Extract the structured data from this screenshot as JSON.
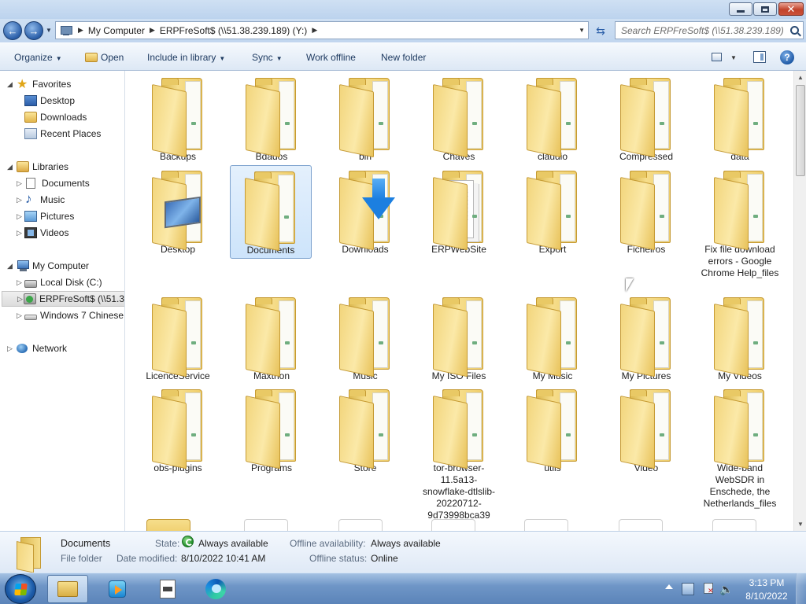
{
  "window": {
    "controls": {
      "minimize": "",
      "maximize": "",
      "close": "✕"
    }
  },
  "address": {
    "crumbs": [
      "My Computer",
      "ERPFreSoft$ (\\\\51.38.239.189) (Y:)"
    ],
    "search_placeholder": "Search ERPFreSoft$ (\\\\51.38.239.189) (..."
  },
  "toolbar": {
    "organize": "Organize",
    "open": "Open",
    "include_in_library": "Include in library",
    "sync": "Sync",
    "work_offline": "Work offline",
    "new_folder": "New folder",
    "help": "?"
  },
  "nav": {
    "favorites": {
      "label": "Favorites",
      "items": [
        "Desktop",
        "Downloads",
        "Recent Places"
      ]
    },
    "libraries": {
      "label": "Libraries",
      "items": [
        "Documents",
        "Music",
        "Pictures",
        "Videos"
      ]
    },
    "computer": {
      "label": "My Computer",
      "items": [
        "Local Disk (C:)",
        "ERPFreSoft$ (\\\\51.38.239.189) (Y:)",
        "Windows 7 Chinese"
      ]
    },
    "network": {
      "label": "Network"
    }
  },
  "folders": [
    {
      "name": "Backups",
      "overlay": "none"
    },
    {
      "name": "Bdados",
      "overlay": "none"
    },
    {
      "name": "bin",
      "overlay": "none"
    },
    {
      "name": "Chaves",
      "overlay": "none"
    },
    {
      "name": "claudio",
      "overlay": "none"
    },
    {
      "name": "Compressed",
      "overlay": "none"
    },
    {
      "name": "data",
      "overlay": "none"
    },
    {
      "name": "Desktop",
      "overlay": "desktop"
    },
    {
      "name": "Documents",
      "overlay": "none",
      "selected": true
    },
    {
      "name": "Downloads",
      "overlay": "downloads"
    },
    {
      "name": "ERPWebSite",
      "overlay": "documents"
    },
    {
      "name": "Export",
      "overlay": "none"
    },
    {
      "name": "Ficheiros",
      "overlay": "none"
    },
    {
      "name": "Fix file download errors - Google Chrome Help_files",
      "overlay": "none"
    },
    {
      "name": "LicenceService",
      "overlay": "none"
    },
    {
      "name": "Maxthon",
      "overlay": "none"
    },
    {
      "name": "Music",
      "overlay": "none"
    },
    {
      "name": "My ISO Files",
      "overlay": "none"
    },
    {
      "name": "My Music",
      "overlay": "none"
    },
    {
      "name": "My Pictures",
      "overlay": "none"
    },
    {
      "name": "My Videos",
      "overlay": "none"
    },
    {
      "name": "obs-plugins",
      "overlay": "none"
    },
    {
      "name": "Programs",
      "overlay": "none"
    },
    {
      "name": "Store",
      "overlay": "none"
    },
    {
      "name": "tor-browser-11.5a13-snowflake-dtlslib-20220712-9d73998bca39",
      "overlay": "none"
    },
    {
      "name": "utils",
      "overlay": "none"
    },
    {
      "name": "Video",
      "overlay": "none"
    },
    {
      "name": "Wide-band WebSDR in Enschede, the Netherlands_files",
      "overlay": "none"
    }
  ],
  "details": {
    "name": "Documents",
    "type": "File folder",
    "state_label": "State:",
    "state_value": "Always available",
    "modified_label": "Date modified:",
    "modified_value": "8/10/2022 10:41 AM",
    "offline_avail_label": "Offline availability:",
    "offline_avail_value": "Always available",
    "offline_status_label": "Offline status:",
    "offline_status_value": "Online"
  },
  "taskbar": {
    "time": "3:13 PM",
    "date": "8/10/2022"
  },
  "colors": {
    "chrome_blue": "#c1d6ef",
    "selection": "#cde4fb",
    "folder_yellow": "#f6de8c"
  }
}
